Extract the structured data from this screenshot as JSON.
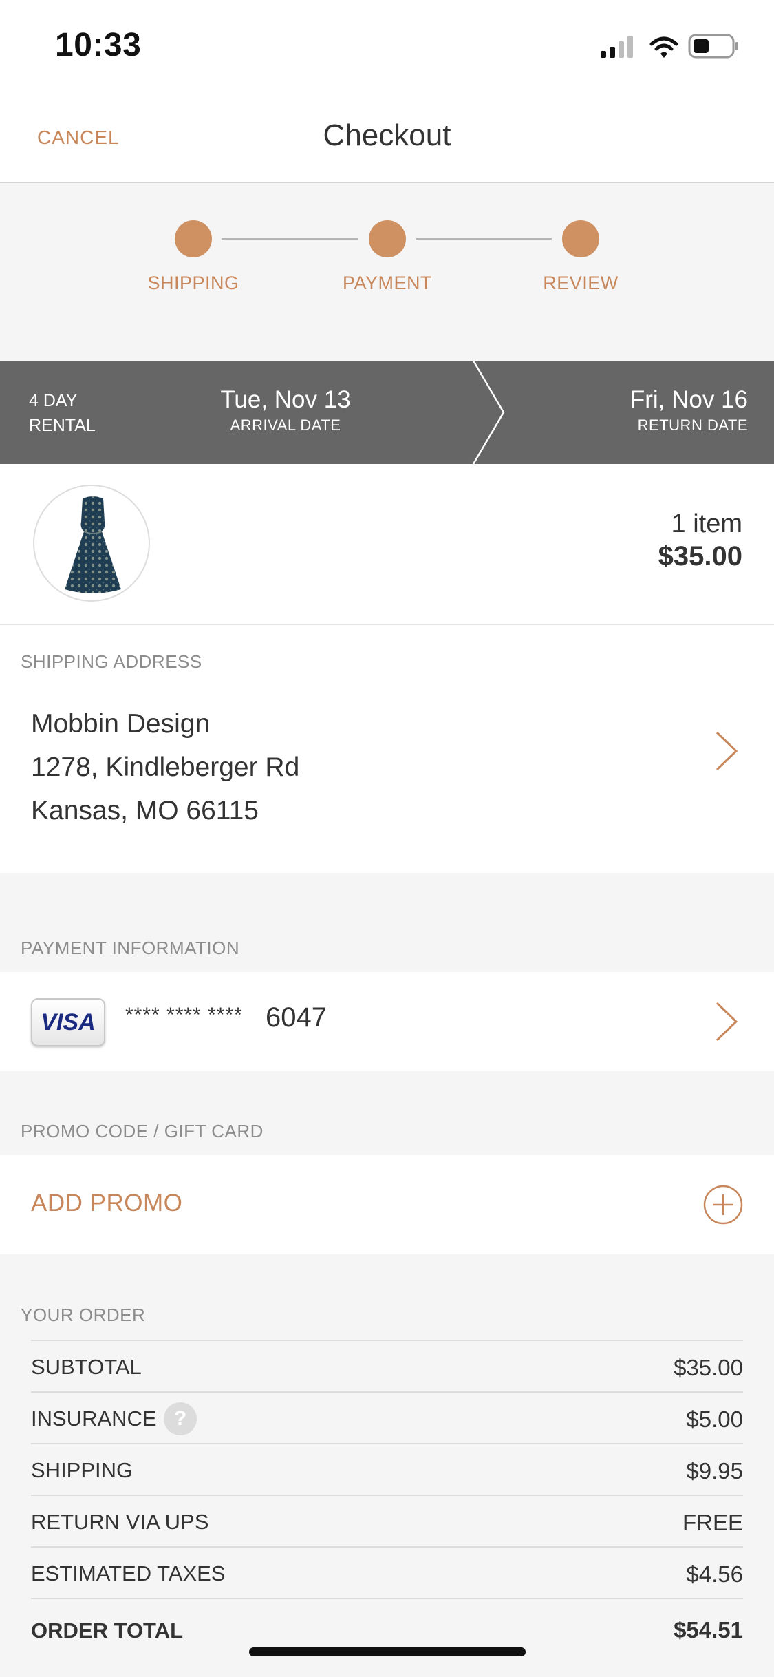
{
  "status_bar": {
    "time": "10:33"
  },
  "nav": {
    "cancel_label": "CANCEL",
    "title": "Checkout"
  },
  "steps": [
    {
      "label": "SHIPPING"
    },
    {
      "label": "PAYMENT"
    },
    {
      "label": "REVIEW"
    }
  ],
  "rental": {
    "length_line1": "4 DAY",
    "length_line2": "RENTAL",
    "arrival_date": "Tue, Nov 13",
    "arrival_label": "ARRIVAL DATE",
    "return_date": "Fri, Nov 16",
    "return_label": "RETURN DATE"
  },
  "cart": {
    "item_count": "1 item",
    "item_total": "$35.00"
  },
  "shipping": {
    "section_label": "SHIPPING ADDRESS",
    "name": "Mobbin Design",
    "street": "1278, Kindleberger Rd",
    "city_line": "Kansas, MO 66115"
  },
  "payment": {
    "section_label": "PAYMENT INFORMATION",
    "card_brand": "VISA",
    "card_mask": "**** **** ****",
    "card_last4": "6047"
  },
  "promo": {
    "section_label": "PROMO CODE / GIFT CARD",
    "add_label": "ADD PROMO"
  },
  "order": {
    "section_label": "YOUR ORDER",
    "rows": [
      {
        "label": "SUBTOTAL",
        "value": "$35.00"
      },
      {
        "label": "INSURANCE",
        "value": "$5.00"
      },
      {
        "label": "SHIPPING",
        "value": "$9.95"
      },
      {
        "label": "RETURN VIA UPS",
        "value": "FREE"
      },
      {
        "label": "ESTIMATED TAXES",
        "value": "$4.56"
      }
    ],
    "total_label": "ORDER TOTAL",
    "total_value": "$54.51",
    "help_glyph": "?"
  },
  "colors": {
    "accent": "#cf9162",
    "accent_text": "#c8875a",
    "rental_bar": "#666666",
    "background": "#f5f5f5"
  }
}
